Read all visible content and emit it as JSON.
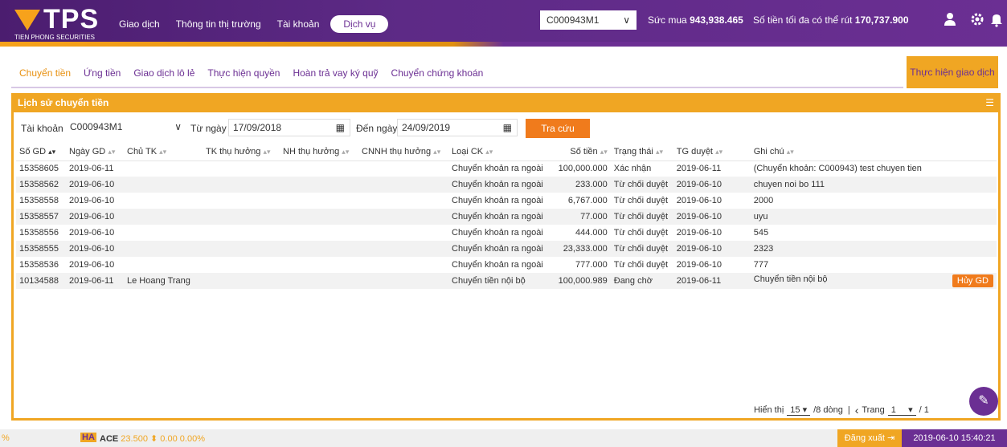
{
  "header": {
    "logo": "TPS",
    "logo_sub": "TIEN PHONG SECURITIES",
    "nav": [
      "Giao dịch",
      "Thông tin thị trường",
      "Tài khoản",
      "Dịch vụ"
    ],
    "account": "C000943M1",
    "power_label": "Sức mua",
    "power_value": "943,938.465",
    "cash_label": "Số tiền tối đa có thể rút",
    "cash_value": "170,737.900"
  },
  "subnav": {
    "tabs": [
      "Chuyển tiền",
      "Ứng tiền",
      "Giao dịch lô lẻ",
      "Thực hiện quyền",
      "Hoàn trả vay ký quỹ",
      "Chuyển chứng khoán"
    ],
    "action": "Thực hiện giao dịch"
  },
  "panel": {
    "title": "Lịch sử chuyển tiền",
    "filter": {
      "account_label": "Tài khoản",
      "account_value": "C000943M1",
      "from_label": "Từ ngày",
      "from_value": "17/09/2018",
      "to_label": "Đến ngày",
      "to_value": "24/09/2019",
      "search_label": "Tra cứu"
    },
    "columns": [
      "Số GD",
      "Ngày GD",
      "Chủ TK",
      "TK thụ hưởng",
      "NH thụ hưởng",
      "CNNH thụ hưởng",
      "Loại CK",
      "Số tiền",
      "Trạng thái",
      "TG duyệt",
      "Ghi chú"
    ],
    "rows": [
      [
        "15358605",
        "2019-06-11",
        "",
        "",
        "",
        "",
        "Chuyển khoản ra ngoài",
        "100,000.000",
        "Xác nhận",
        "2019-06-11",
        "(Chuyển khoản: C000943) test chuyen tien"
      ],
      [
        "15358562",
        "2019-06-10",
        "",
        "",
        "",
        "",
        "Chuyển khoản ra ngoài",
        "233.000",
        "Từ chối duyệt",
        "2019-06-10",
        "chuyen noi bo 111"
      ],
      [
        "15358558",
        "2019-06-10",
        "",
        "",
        "",
        "",
        "Chuyển khoản ra ngoài",
        "6,767.000",
        "Từ chối duyệt",
        "2019-06-10",
        "2000"
      ],
      [
        "15358557",
        "2019-06-10",
        "",
        "",
        "",
        "",
        "Chuyển khoản ra ngoài",
        "77.000",
        "Từ chối duyệt",
        "2019-06-10",
        "uyu"
      ],
      [
        "15358556",
        "2019-06-10",
        "",
        "",
        "",
        "",
        "Chuyển khoản ra ngoài",
        "444.000",
        "Từ chối duyệt",
        "2019-06-10",
        "545"
      ],
      [
        "15358555",
        "2019-06-10",
        "",
        "",
        "",
        "",
        "Chuyển khoản ra ngoài",
        "23,333.000",
        "Từ chối duyệt",
        "2019-06-10",
        "2323"
      ],
      [
        "15358536",
        "2019-06-10",
        "",
        "",
        "",
        "",
        "Chuyển khoản ra ngoài",
        "777.000",
        "Từ chối duyệt",
        "2019-06-10",
        "777"
      ],
      [
        "10134588",
        "2019-06-11",
        "Le Hoang Trang",
        "",
        "",
        "",
        "Chuyển tiền nội bộ",
        "100,000.989",
        "Đang chờ",
        "2019-06-11",
        "Chuyển tiền nội bộ"
      ]
    ],
    "cancel_label": "Hủy GD",
    "pager": {
      "show_label": "Hiển thị",
      "page_size": "15",
      "rows_text": "/8 dòng",
      "page_label": "Trang",
      "page": "1",
      "total": "/ 1"
    }
  },
  "footer": {
    "pct": "%",
    "exchange": "HA",
    "symbol": "ACE",
    "price": "23.500",
    "change": "0.00",
    "change_pct": "0.00%",
    "logout": "Đăng xuất",
    "datetime": "2019-06-10 15:40:21"
  }
}
